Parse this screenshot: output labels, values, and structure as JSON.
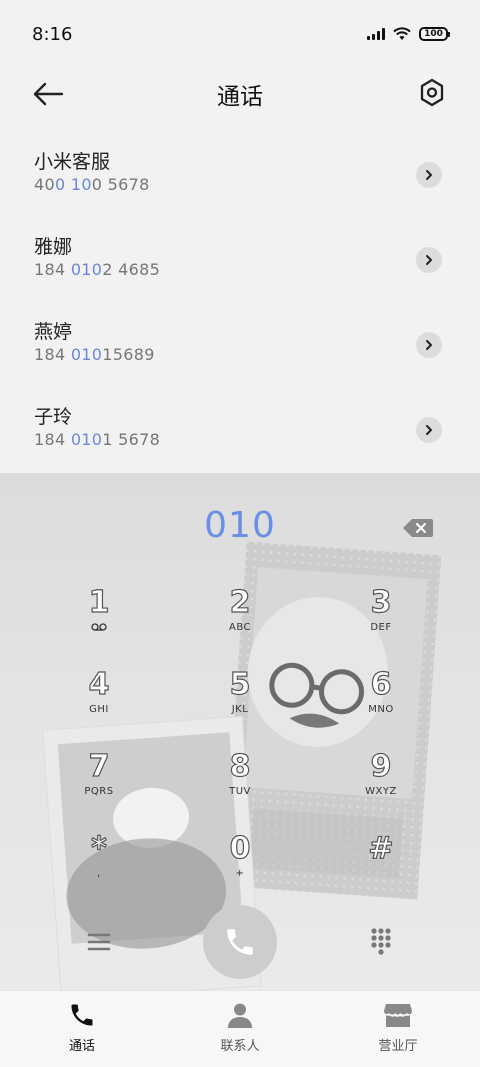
{
  "status_bar": {
    "time": "8:16",
    "battery": "100"
  },
  "header": {
    "title": "通话"
  },
  "contacts": [
    {
      "name": "小米客服",
      "number_parts": [
        "40",
        "0 10",
        "0 5678"
      ]
    },
    {
      "name": "雅娜",
      "number_parts": [
        "184 ",
        "010",
        "2 4685"
      ]
    },
    {
      "name": "燕婷",
      "number_parts": [
        "184 ",
        "010",
        "15689"
      ]
    },
    {
      "name": "子玲",
      "number_parts": [
        "184 ",
        "010",
        "1 5678"
      ]
    }
  ],
  "dialer": {
    "input": "010",
    "keys": [
      {
        "digit": "1",
        "letters": ""
      },
      {
        "digit": "2",
        "letters": "ABC"
      },
      {
        "digit": "3",
        "letters": "DEF"
      },
      {
        "digit": "4",
        "letters": "GHI"
      },
      {
        "digit": "5",
        "letters": "JKL"
      },
      {
        "digit": "6",
        "letters": "MNO"
      },
      {
        "digit": "7",
        "letters": "PQRS"
      },
      {
        "digit": "8",
        "letters": "TUV"
      },
      {
        "digit": "9",
        "letters": "WXYZ"
      },
      {
        "digit": "*",
        "letters": ","
      },
      {
        "digit": "0",
        "letters": "+"
      },
      {
        "digit": "#",
        "letters": ""
      }
    ]
  },
  "bottom_nav": [
    {
      "label": "通话",
      "icon": "phone-icon",
      "active": true
    },
    {
      "label": "联系人",
      "icon": "person-icon",
      "active": false
    },
    {
      "label": "营业厅",
      "icon": "store-icon",
      "active": false
    }
  ],
  "colors": {
    "highlight": "#6b86e0",
    "dial_text": "#6b8fe6"
  }
}
